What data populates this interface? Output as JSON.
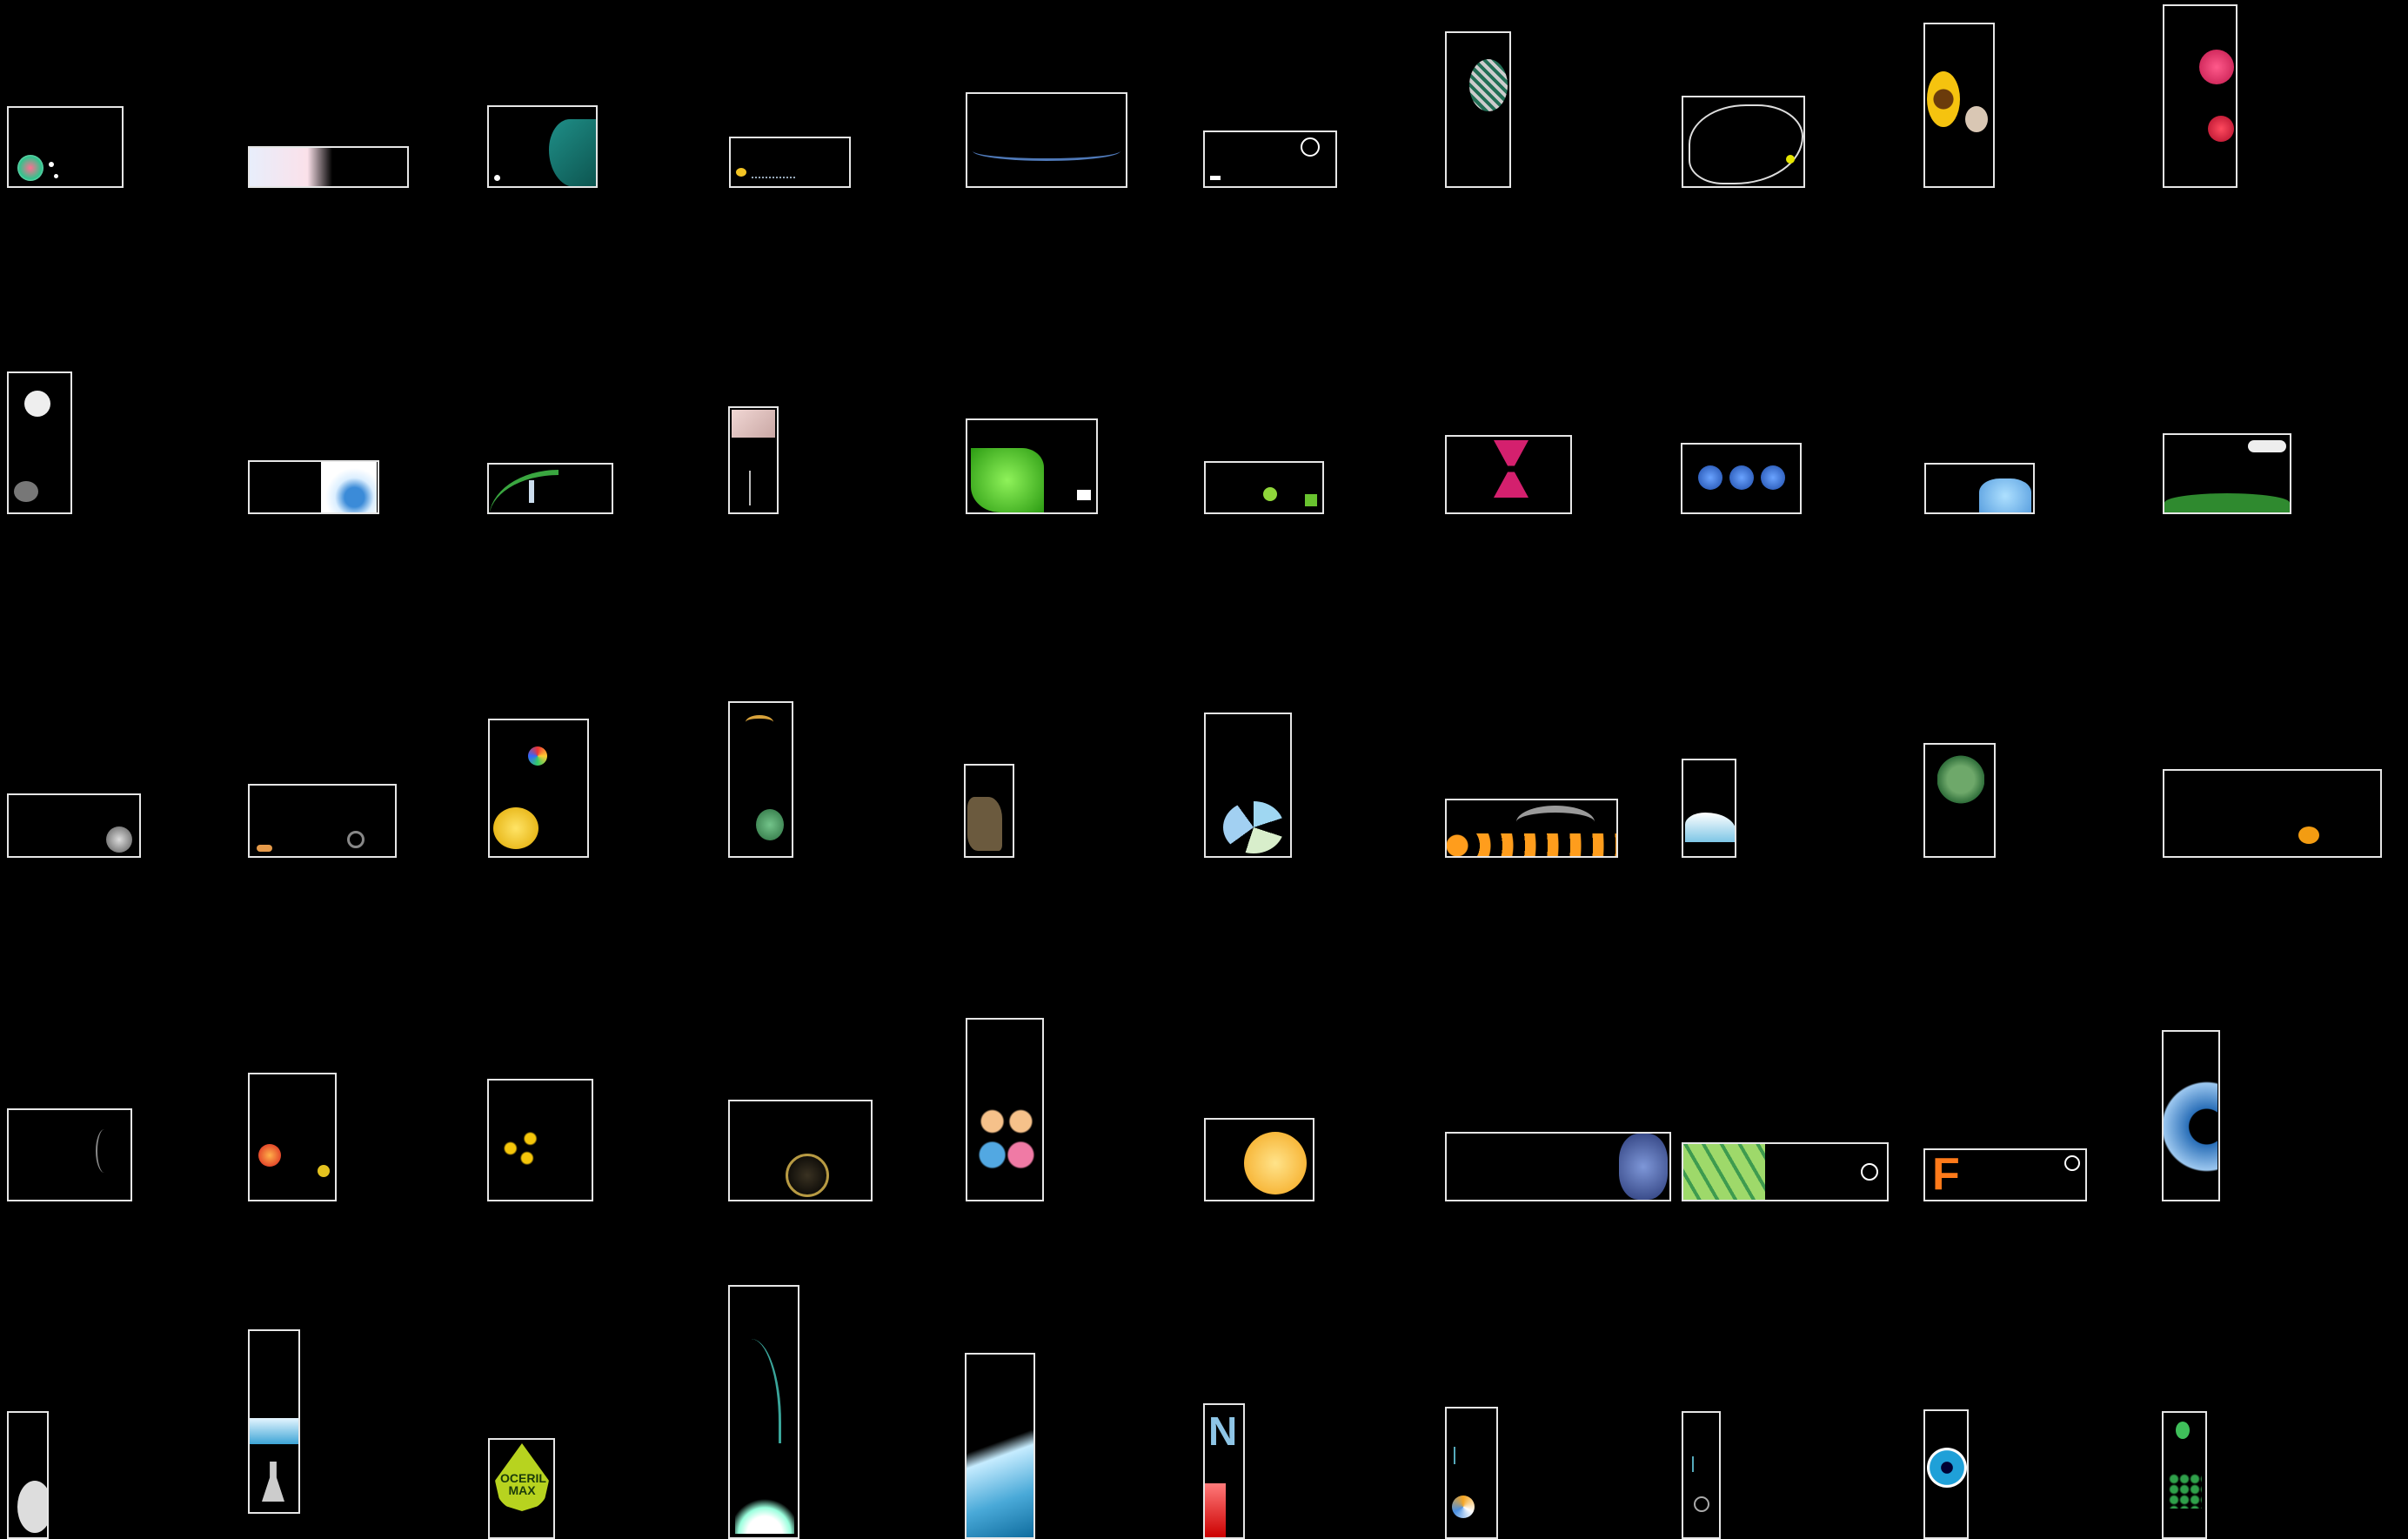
{
  "gallery": {
    "background": "#000000",
    "frame_color": "#e6e6e6"
  },
  "thumbnails": {
    "t42": {
      "brand_label": "OCERIL MAX",
      "brand_color": "#b7d31f"
    },
    "t44": {
      "glyph": "N"
    },
    "t38": {
      "glyph": "F",
      "accent": "#ff7a1a"
    }
  }
}
